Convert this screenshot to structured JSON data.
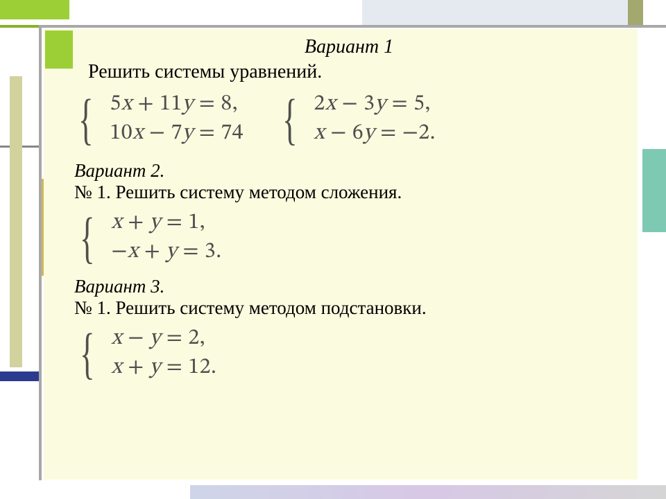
{
  "variant1": {
    "title": "Вариант 1",
    "task": "Решить системы  уравнений.",
    "systems": [
      {
        "eq1": "5x + 11y = 8,",
        "eq2": "10x − 7y = 74"
      },
      {
        "eq1": "2x − 3y  = 5,",
        "eq2": "x − 6y = −2."
      }
    ]
  },
  "variant2": {
    "title": "Вариант 2.",
    "task": "№ 1. Решить систему методом сложения.",
    "system": {
      "eq1": " x + y  = 1,",
      "eq2": "−x + y = 3."
    }
  },
  "variant3": {
    "title": "Вариант 3.",
    "task": "№ 1. Решить систему методом подстановки.",
    "system": {
      "eq1": "x − y  = 2,",
      "eq2": "x + y = 12."
    }
  }
}
